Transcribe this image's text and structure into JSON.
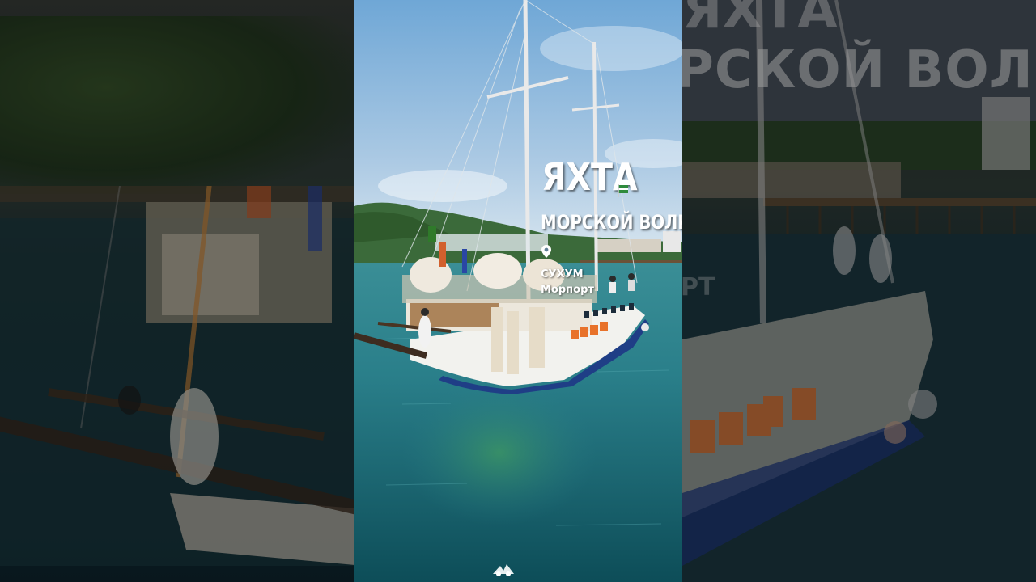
{
  "overlay": {
    "title": "ЯХТА",
    "subtitle": "МОРСКОЙ ВОЛК",
    "location_city": "СУХУМ",
    "location_place": "Морпорт"
  },
  "side_ghosts": {
    "right_title": "РСКОЙ ВОЛК",
    "right_top": "ЯХТА",
    "right_sub": "РТ"
  },
  "icons": {
    "pin": "map-pin-icon",
    "flag": "flag-icon",
    "watermark": "watermark-logo-icon"
  },
  "colors": {
    "sky_top": "#6fa7d6",
    "sky_bottom": "#c9dcea",
    "sea_top": "#2c8a9a",
    "sea_bottom": "#0f4f5c",
    "hull_blue": "#1f3e86",
    "hull_white": "#f2f2ee",
    "life_vest": "#e8722a"
  }
}
